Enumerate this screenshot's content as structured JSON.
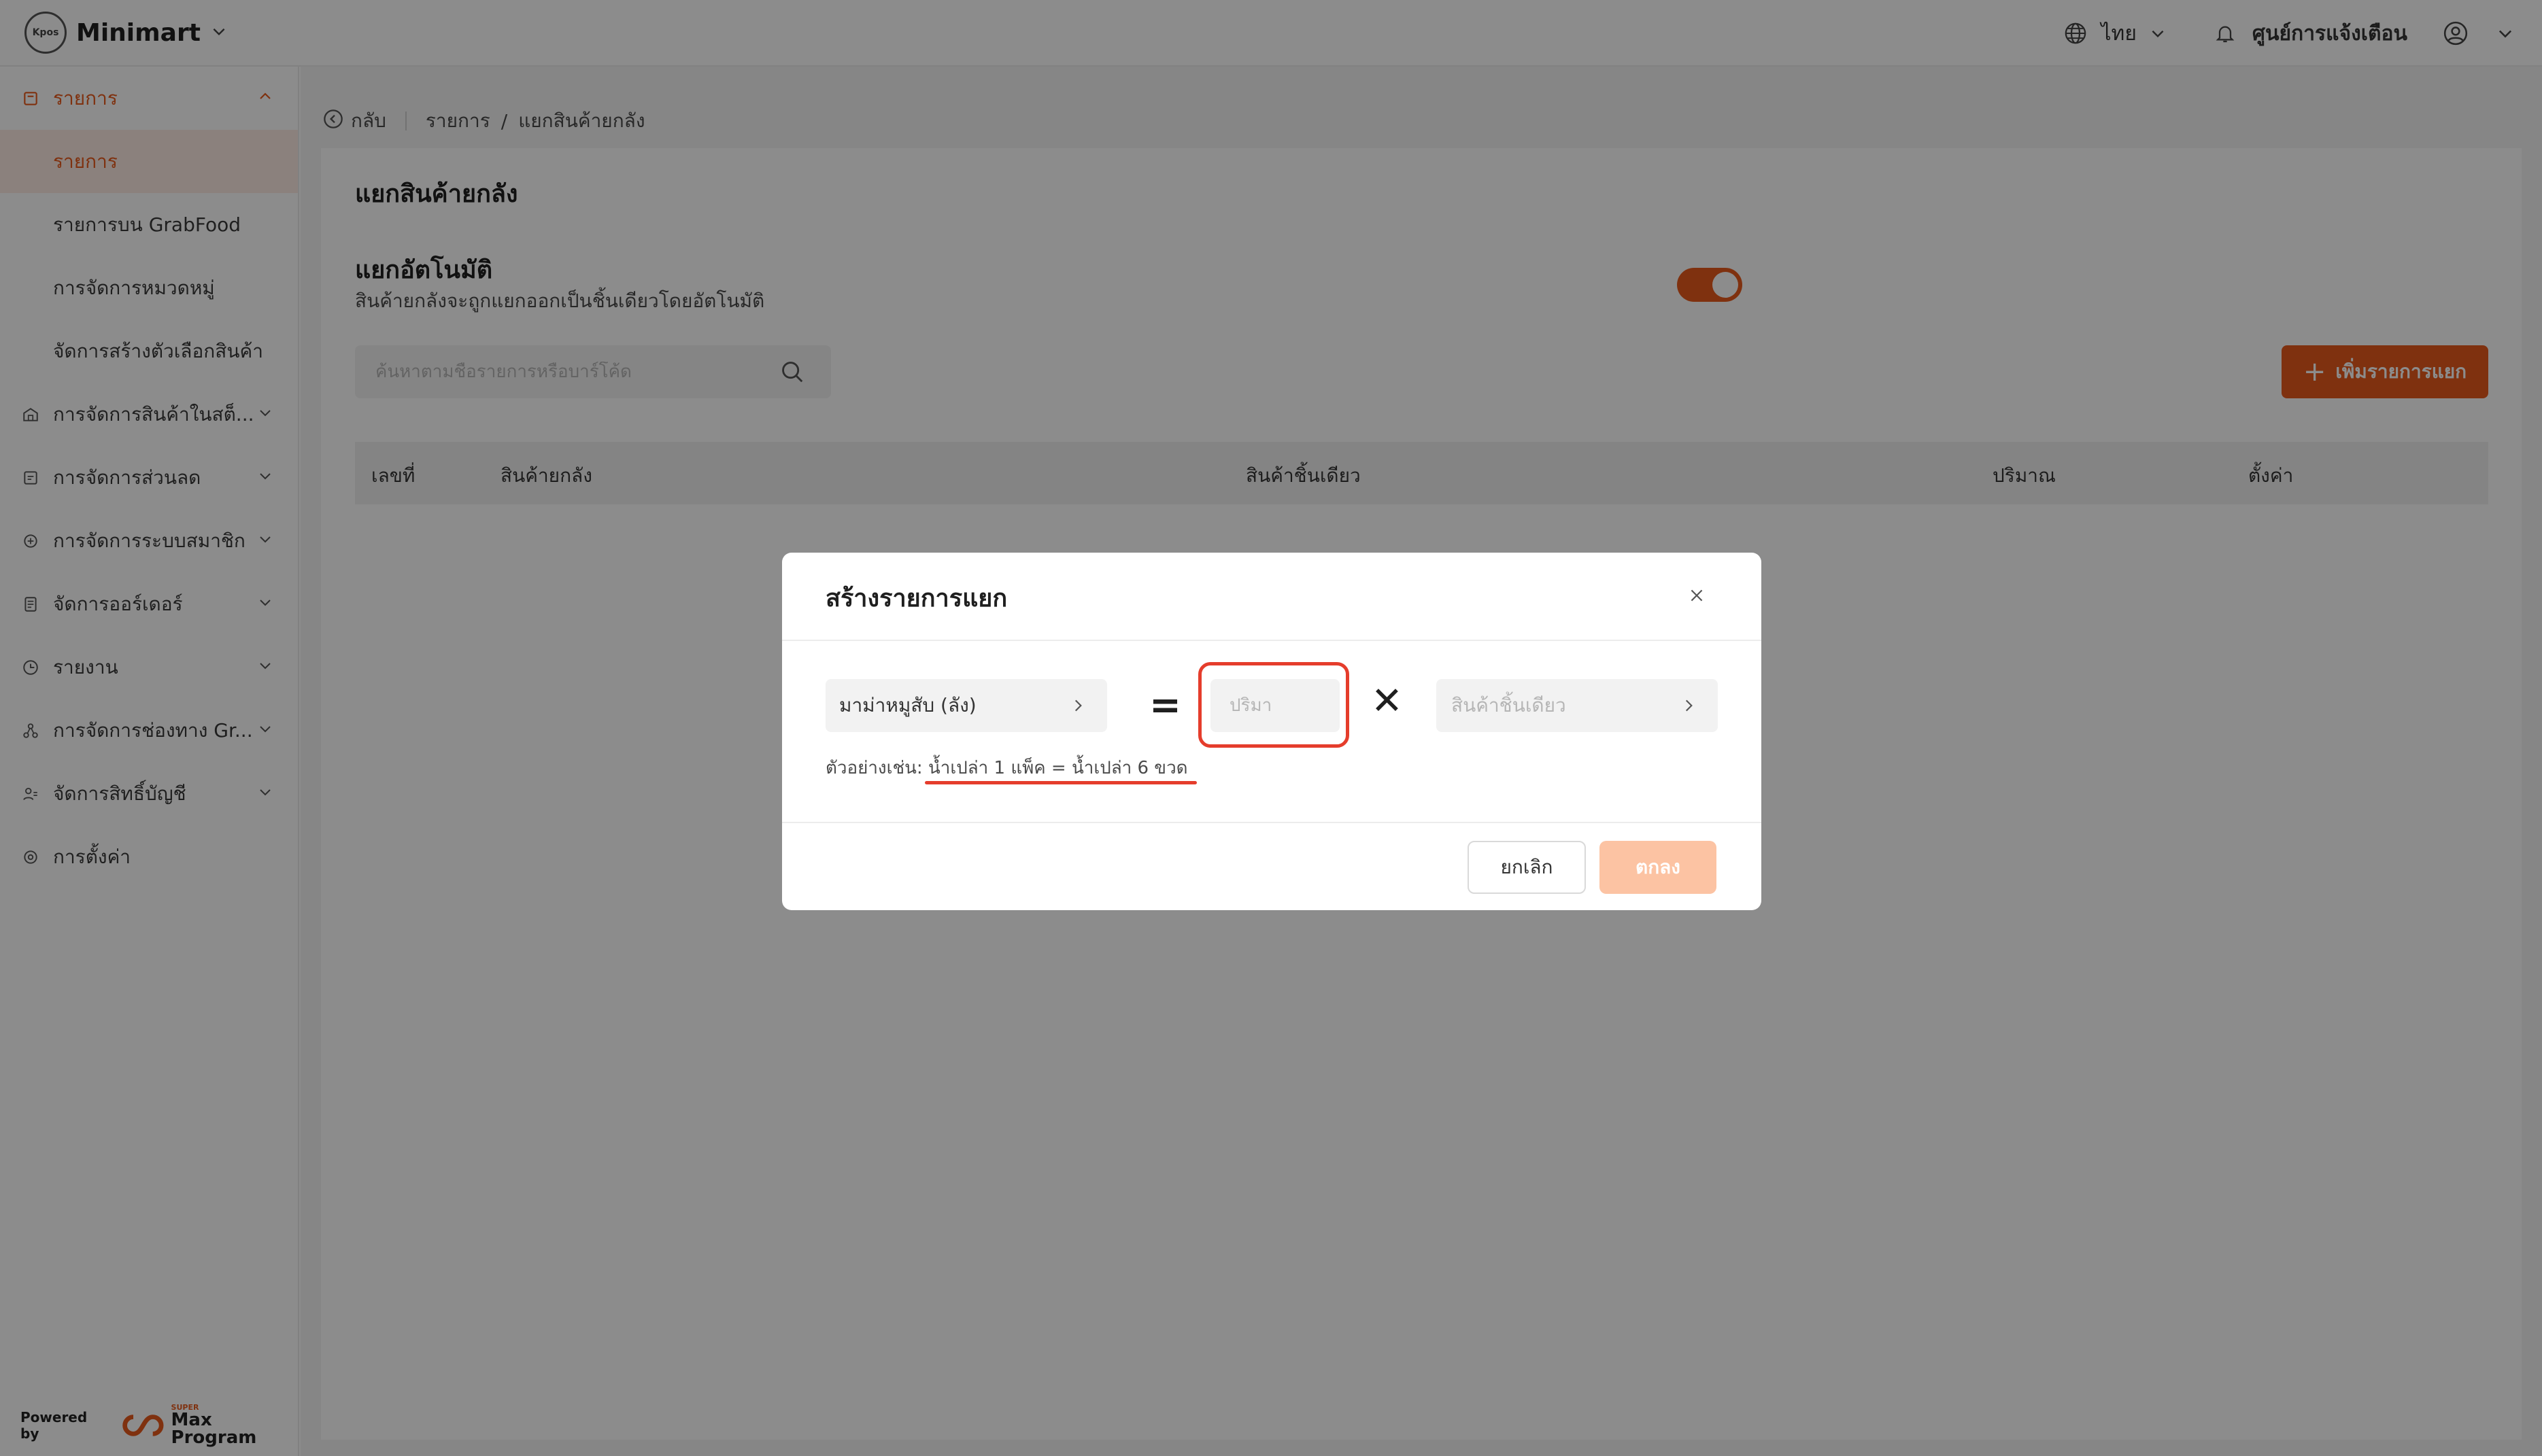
{
  "header": {
    "logo_text": "Kpos",
    "app_name": "Minimart",
    "language": "ไทย",
    "notifications": "ศูนย์การแจ้งเตือน"
  },
  "sidebar": {
    "groups": [
      {
        "label": "รายการ",
        "icon": "list-icon",
        "expanded": true
      },
      {
        "label": "การจัดการสินค้าในสต็...",
        "icon": "warehouse-icon"
      },
      {
        "label": "การจัดการส่วนลด",
        "icon": "discount-icon"
      },
      {
        "label": "การจัดการระบบสมาชิก",
        "icon": "member-icon"
      },
      {
        "label": "จัดการออร์เดอร์",
        "icon": "order-icon"
      },
      {
        "label": "รายงาน",
        "icon": "report-icon"
      },
      {
        "label": "การจัดการช่องทาง Gr...",
        "icon": "channel-icon"
      },
      {
        "label": "จัดการสิทธิ์บัญชี",
        "icon": "account-icon"
      },
      {
        "label": "การตั้งค่า",
        "icon": "settings-icon"
      }
    ],
    "subitems": [
      "รายการ",
      "รายการบน GrabFood",
      "การจัดการหมวดหมู่",
      "จัดการสร้างตัวเลือกสินค้า"
    ],
    "powered_by": "Powered by",
    "brand_small": "SUPER",
    "brand": "Max Program"
  },
  "breadcrumb": {
    "back": "กลับ",
    "items": [
      "รายการ",
      "แยกสินค้ายกลัง"
    ],
    "separator": "/"
  },
  "page": {
    "title": "แยกสินค้ายกลัง",
    "auto_split_title": "แยกอัตโนมัติ",
    "auto_split_desc": "สินค้ายกลังจะถูกแยกออกเป็นชิ้นเดียวโดยอัตโนมัติ",
    "auto_split_enabled": true,
    "search_placeholder": "ค้นหาตามชื่อรายการหรือบาร์โค้ด",
    "add_button": "เพิ่มรายการแยก",
    "columns": [
      "เลขที่",
      "สินค้ายกลัง",
      "สินค้าชิ้นเดียว",
      "ปริมาณ",
      "ตั้งค่า"
    ]
  },
  "modal": {
    "title": "สร้างรายการแยก",
    "bulk_item": "มาม่าหมูสับ (ลัง)",
    "equals": "=",
    "quantity_placeholder": "ปริมา",
    "times": "✕",
    "single_item_placeholder": "สินค้าชิ้นเดียว",
    "example_label": "ตัวอย่างเช่น:",
    "example_text": "น้ำเปล่า 1 แพ็ค = น้ำเปล่า 6 ขวด",
    "cancel": "ยกเลิก",
    "ok": "ตกลง"
  },
  "colors": {
    "accent": "#e85a1c",
    "highlight": "#e53d2c",
    "ok_disabled": "#fcc3a3"
  }
}
